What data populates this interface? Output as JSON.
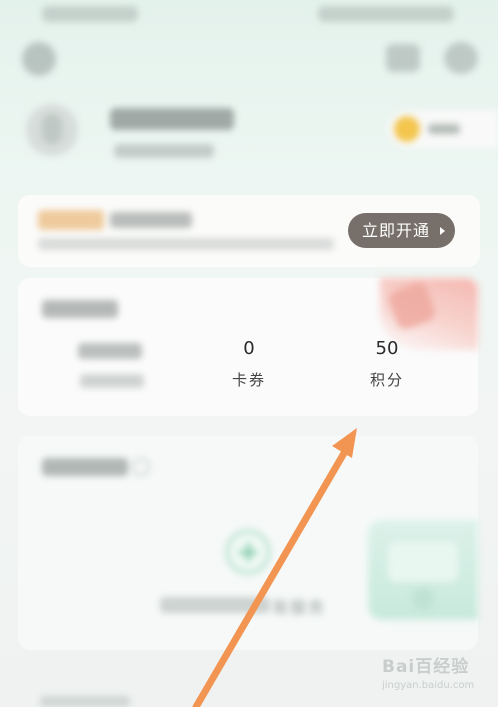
{
  "vip_banner": {
    "open_button_label": "立即开通"
  },
  "assets": {
    "coupons": {
      "value": "0",
      "label": "卡券"
    },
    "points": {
      "value": "50",
      "label": "积分"
    }
  },
  "services": {
    "empty_hint_suffix": "易服务"
  },
  "watermark": {
    "brand": "Bai百经验",
    "url": "jingyan.baidu.com"
  },
  "annotation": {
    "arrow_color": "#f29552"
  },
  "colors": {
    "button_bg": "#77706a",
    "accent_green": "#6fc39d",
    "coin": "#f4c64e"
  }
}
